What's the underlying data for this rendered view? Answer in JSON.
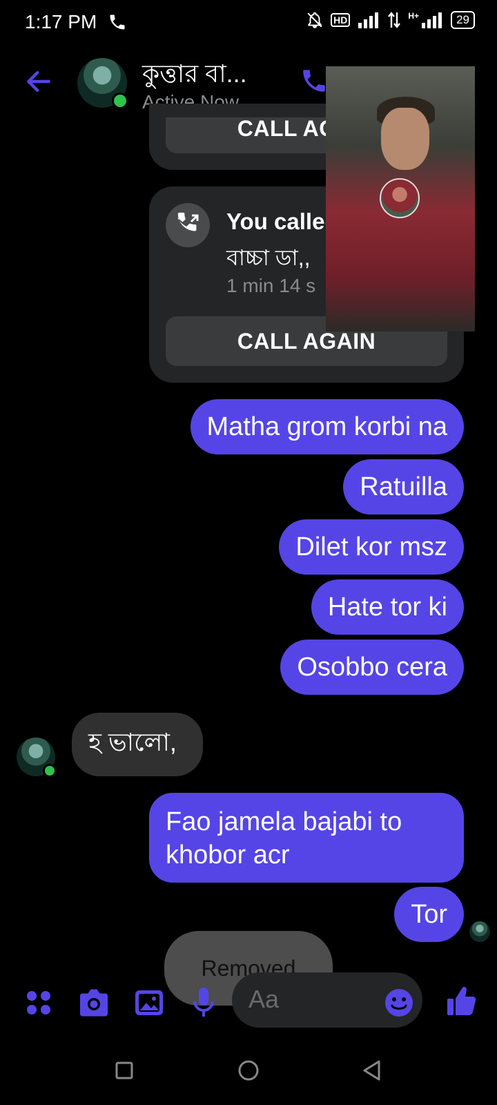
{
  "status_bar": {
    "time": "1:17 PM",
    "hd": "HD",
    "net": "H+",
    "battery": "29"
  },
  "header": {
    "title": "কুত্তার বা...",
    "subtitle": "Active Now"
  },
  "call_cards": [
    {
      "button": "CALL AGAIN"
    },
    {
      "title": "You called",
      "subtitle": "বাচ্চা ডা,,",
      "duration": "1 min 14 s",
      "button": "CALL AGAIN"
    }
  ],
  "messages": {
    "sent_1": "Matha grom korbi na",
    "sent_2": "Ratuilla",
    "sent_3": "Dilet kor msz",
    "sent_4": "Hate tor ki",
    "sent_5": "Osobbo cera",
    "recv_1": "হ ভালো,",
    "sent_6_line1": "Fao jamela bajabi to",
    "sent_6_line2": "khobor acr",
    "sent_7": "Tor"
  },
  "toast": "Removed",
  "composer": {
    "placeholder": "Aa"
  },
  "colors": {
    "accent": "#5545e6",
    "background": "#000000",
    "bubble_received": "#303030",
    "card": "#242526",
    "online": "#31c24d"
  },
  "icons": [
    "phone-icon",
    "dnd-icon",
    "signal-icon",
    "back-arrow-icon",
    "voice-call-icon",
    "call-outgoing-icon",
    "apps-icon",
    "camera-icon",
    "gallery-icon",
    "mic-icon",
    "emoji-icon",
    "thumbs-up-icon",
    "nav-recent-icon",
    "nav-home-icon",
    "nav-back-icon"
  ]
}
